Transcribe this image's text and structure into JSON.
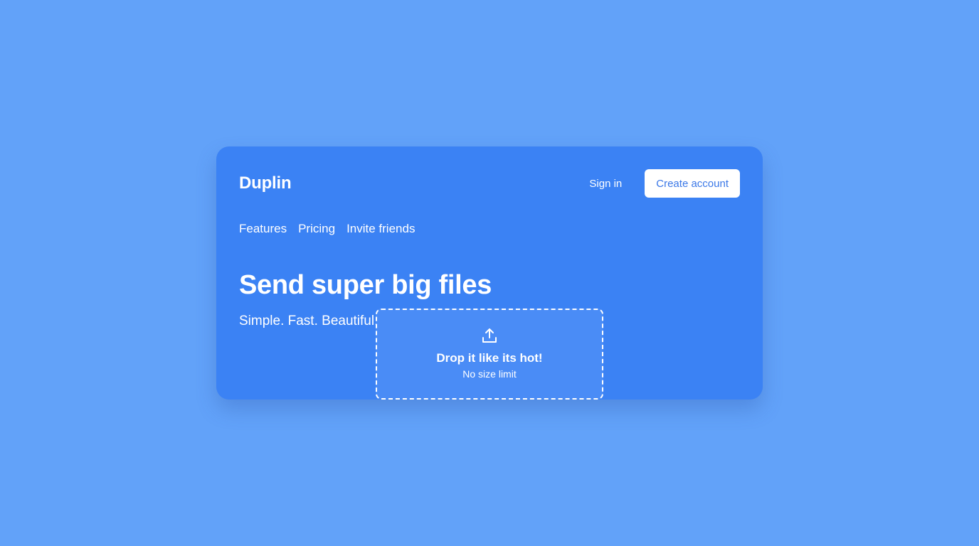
{
  "brand": {
    "name": "Duplin"
  },
  "header": {
    "sign_in_label": "Sign in",
    "create_account_label": "Create account"
  },
  "nav": {
    "items": [
      {
        "label": "Features"
      },
      {
        "label": "Pricing"
      },
      {
        "label": "Invite friends"
      }
    ]
  },
  "hero": {
    "title": "Send super big files",
    "subtitle": "Simple. Fast. Beautiful."
  },
  "dropzone": {
    "icon": "upload-icon",
    "title": "Drop it like its hot!",
    "subtitle": "No size limit"
  },
  "colors": {
    "page_background": "#62a2f9",
    "card_background": "#3b82f4",
    "button_text": "#3b78e7"
  }
}
